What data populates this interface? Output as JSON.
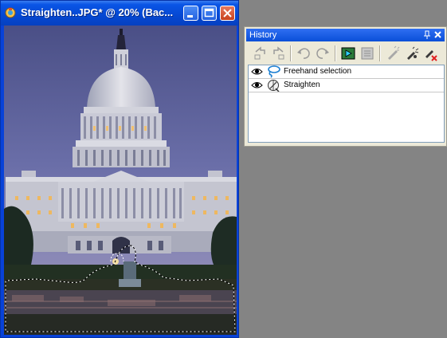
{
  "document_window": {
    "title": "Straighten..JPG* @  20% (Bac...",
    "buttons": {
      "minimize": "minimize",
      "maximize": "maximize",
      "close": "close"
    }
  },
  "history_palette": {
    "title": "History",
    "toolbar": [
      "undo-to-here-icon",
      "redo-to-here-icon",
      "undo-icon",
      "redo-icon",
      "command-play-icon",
      "quickscript-icon",
      "clear-command-icon",
      "delete-history-icon",
      "clear-history-icon"
    ],
    "items": [
      {
        "label": "Freehand selection",
        "icon": "freehand-lasso-icon"
      },
      {
        "label": "Straighten",
        "icon": "straighten-icon"
      }
    ]
  }
}
